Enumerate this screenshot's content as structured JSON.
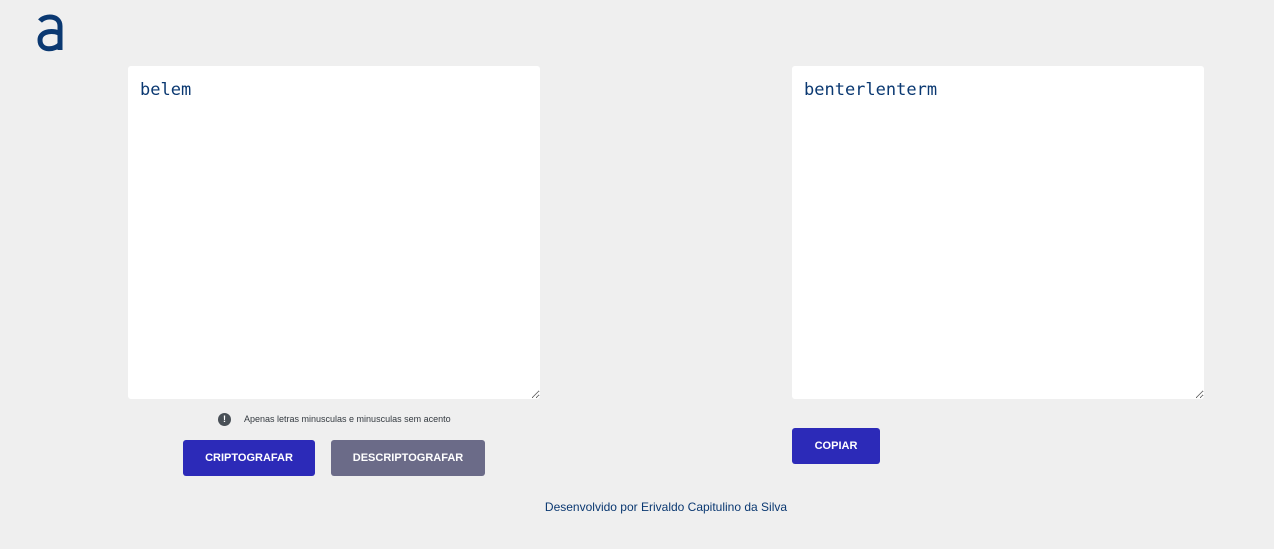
{
  "brand": {
    "logo_icon": "alura-a-logo-icon",
    "logo_color": "#0a3871"
  },
  "input": {
    "value": "belem"
  },
  "output": {
    "value": "benterlenterm"
  },
  "hint": {
    "icon": "exclamation-circle-icon",
    "text": "Apenas letras minusculas e minusculas sem acento"
  },
  "buttons": {
    "encrypt_label": "CRIPTOGRAFAR",
    "decrypt_label": "DESCRIPTOGRAFAR",
    "copy_label": "COPIAR"
  },
  "footer": {
    "text": "Desenvolvido por Erivaldo Capitulino da Silva"
  },
  "colors": {
    "background": "#efefef",
    "primary": "#2c2ab8",
    "secondary": "#6b6b88",
    "text_dark_blue": "#0a3871"
  }
}
